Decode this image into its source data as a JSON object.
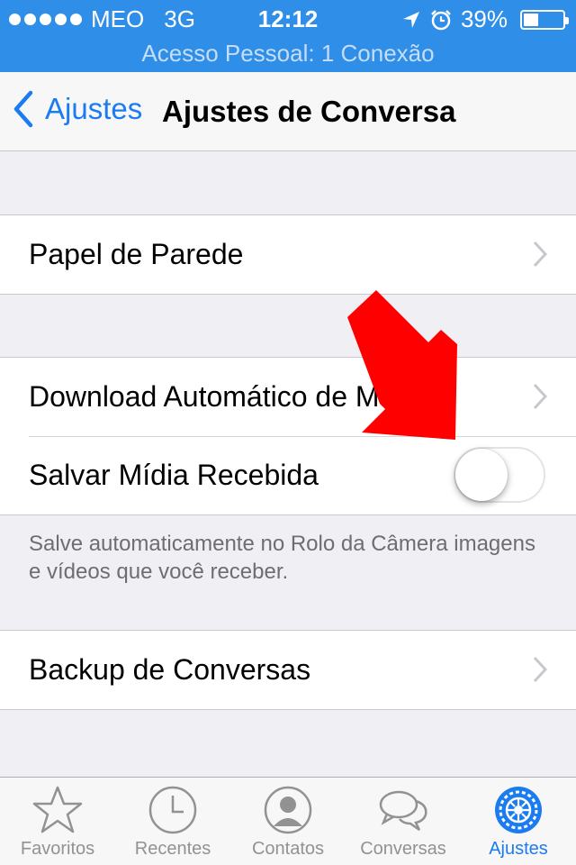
{
  "status_bar": {
    "carrier": "MEO",
    "network": "3G",
    "time": "12:12",
    "battery": "39%",
    "icons": [
      "signal-dots",
      "location-icon",
      "alarm-icon",
      "battery-icon"
    ]
  },
  "hotspot": {
    "text": "Acesso Pessoal: 1 Conexão"
  },
  "nav": {
    "back_label": "Ajustes",
    "title": "Ajustes de Conversa"
  },
  "groups": [
    {
      "rows": [
        {
          "label": "Papel de Parede",
          "accessory": "chevron"
        }
      ]
    },
    {
      "rows": [
        {
          "label": "Download Automático de Mídia",
          "accessory": "chevron"
        },
        {
          "label": "Salvar Mídia Recebida",
          "accessory": "toggle",
          "toggle_on": false
        }
      ]
    },
    {
      "rows": [
        {
          "label": "Backup de Conversas",
          "accessory": "chevron"
        }
      ]
    }
  ],
  "footer_note": "Salve automaticamente no Rolo da Câmera imagens e vídeos que você receber.",
  "tabs": [
    {
      "label": "Favoritos",
      "icon": "star-icon",
      "active": false
    },
    {
      "label": "Recentes",
      "icon": "clock-icon",
      "active": false
    },
    {
      "label": "Contatos",
      "icon": "contact-icon",
      "active": false
    },
    {
      "label": "Conversas",
      "icon": "chat-bubbles-icon",
      "active": false
    },
    {
      "label": "Ajustes",
      "icon": "settings-gear-icon",
      "active": true
    }
  ],
  "colors": {
    "status_bar_bg": "#2f8ee8",
    "accent": "#1b7cf2",
    "annotation_arrow": "#ff0000",
    "background": "#efeff4"
  }
}
